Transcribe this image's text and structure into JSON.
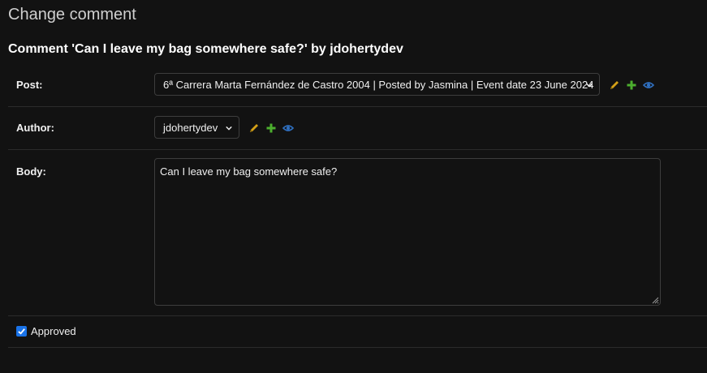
{
  "page": {
    "title": "Change comment",
    "heading": "Comment 'Can I leave my bag somewhere safe?' by jdohertydev"
  },
  "fields": {
    "post": {
      "label": "Post:",
      "selected": "6ª Carrera Marta Fernández de Castro 2004 | Posted by Jasmina | Event date 23 June 2024"
    },
    "author": {
      "label": "Author:",
      "selected": "jdohertydev"
    },
    "body": {
      "label": "Body:",
      "value": "Can I leave my bag somewhere safe?"
    },
    "approved": {
      "label": "Approved",
      "checked": true
    }
  },
  "icons": {
    "edit": "pencil-icon",
    "add": "plus-icon",
    "view": "eye-icon"
  },
  "colors": {
    "background": "#121212",
    "edit_icon": "#d4a017",
    "add_icon": "#4caf2e",
    "view_icon": "#2f6fbf",
    "checkbox": "#1a73e8"
  }
}
